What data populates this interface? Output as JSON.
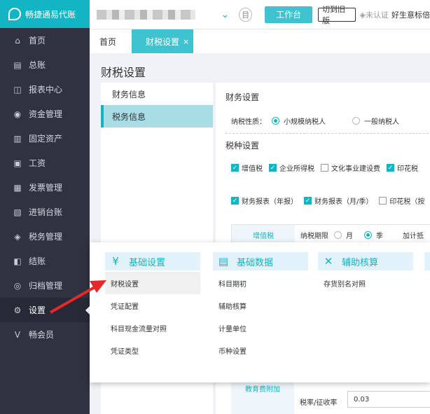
{
  "logo": {
    "text": "畅捷通易代账"
  },
  "sidebar": {
    "items": [
      {
        "label": "首页",
        "icon": "home-icon",
        "glyph": "⌂"
      },
      {
        "label": "总账",
        "icon": "ledger-icon",
        "glyph": "▤"
      },
      {
        "label": "报表中心",
        "icon": "chart-icon",
        "glyph": "◫"
      },
      {
        "label": "资金管理",
        "icon": "coin-icon",
        "glyph": "◉"
      },
      {
        "label": "固定资产",
        "icon": "asset-icon",
        "glyph": "▥"
      },
      {
        "label": "工资",
        "icon": "salary-icon",
        "glyph": "▣"
      },
      {
        "label": "发票管理",
        "icon": "invoice-icon",
        "glyph": "▦"
      },
      {
        "label": "进销台账",
        "icon": "stock-icon",
        "glyph": "▧"
      },
      {
        "label": "税务管理",
        "icon": "tax-icon",
        "glyph": "◈"
      },
      {
        "label": "结账",
        "icon": "close-books-icon",
        "glyph": "◧"
      },
      {
        "label": "归档管理",
        "icon": "archive-icon",
        "glyph": "◎"
      },
      {
        "label": "设置",
        "icon": "gear-icon",
        "glyph": "⚙"
      },
      {
        "label": "畅会员",
        "icon": "member-icon",
        "glyph": "V"
      }
    ],
    "active_index": 11
  },
  "topbar": {
    "workbench": "工作台",
    "switch_old": "切到旧版",
    "auth_status": "◈未认证",
    "company": "好生意标倍"
  },
  "tabs": [
    {
      "label": "首页"
    },
    {
      "label": "财税设置"
    }
  ],
  "tab_close": "×",
  "page": {
    "title": "财税设置"
  },
  "left_panel": {
    "items": [
      "财务信息",
      "税务信息"
    ],
    "active_index": 1
  },
  "finance": {
    "section_title": "财务设置",
    "taxpayer_label": "纳税性质：",
    "taxpayer_options": [
      "小规模纳税人",
      "一般纳税人"
    ],
    "taxpayer_selected": 0
  },
  "tax_types": {
    "section_title": "税种设置",
    "row1": [
      {
        "label": "增值税",
        "checked": true
      },
      {
        "label": "企业所得税",
        "checked": true
      },
      {
        "label": "文化事业建设费",
        "checked": false
      },
      {
        "label": "印花税",
        "checked": true
      }
    ],
    "row2": [
      {
        "label": "财务报表（年报）",
        "checked": true
      },
      {
        "label": "财务报表（月/季）",
        "checked": true
      },
      {
        "label": "印花税（按",
        "checked": false
      }
    ]
  },
  "vat_row": {
    "head": "增值税",
    "period_label": "纳税期限",
    "options": [
      "月",
      "季"
    ],
    "selected": 1,
    "extra": "加计抵"
  },
  "bottom": {
    "edu_label": "教育费附加",
    "rate_label": "税率/征收率",
    "rate_value": "0.03"
  },
  "megamenu": {
    "columns": [
      {
        "title": "基础设置",
        "icon": "yen-icon",
        "glyph": "¥",
        "items": [
          "财税设置",
          "凭证配置",
          "科目现金流量对照",
          "凭证类型"
        ],
        "highlight": 0
      },
      {
        "title": "基础数据",
        "icon": "card-icon",
        "glyph": "▤",
        "items": [
          "科目期初",
          "辅助核算",
          "计量单位",
          "币种设置"
        ],
        "highlight": -1
      },
      {
        "title": "辅助核算",
        "icon": "tools-icon",
        "glyph": "✕",
        "items": [
          "存货别名对照"
        ],
        "highlight": -1
      }
    ]
  },
  "colors": {
    "accent": "#13b5c4",
    "sidebar": "#2e3241",
    "arrow": "#e8272a"
  }
}
